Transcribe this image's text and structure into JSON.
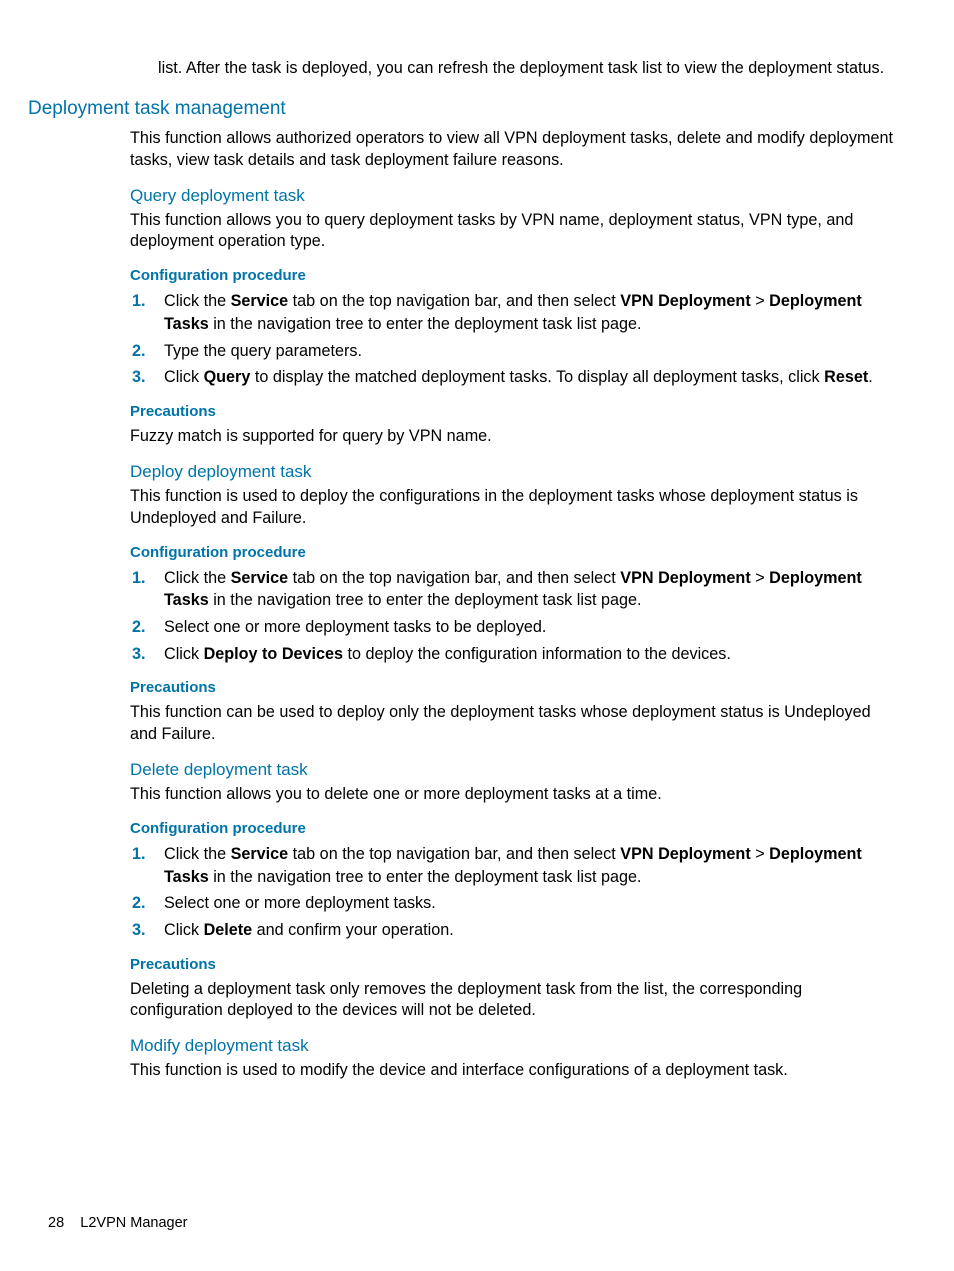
{
  "intro_continuation": "list. After the task is deployed, you can refresh the deployment task list to view the deployment status.",
  "h2_deploy_mgmt": "Deployment task management",
  "deploy_mgmt_desc": "This function allows authorized operators to view all VPN deployment tasks, delete and modify deployment tasks, view task details and task deployment failure reasons.",
  "h3_query": "Query deployment task",
  "query_desc": "This function allows you to query deployment tasks by VPN name, deployment status, VPN type, and deployment operation type.",
  "conf_proc_label": "Configuration procedure",
  "precautions_label": "Precautions",
  "steps_common_1_pre": "Click the ",
  "service_b": "Service",
  "steps_common_1_mid": " tab on the top navigation bar, and then select ",
  "vpn_dep_b": "VPN Deployment",
  "gt": " > ",
  "dep_tasks_b": "Deployment Tasks",
  "steps_common_1_post": " in the navigation tree to enter the deployment task list page.",
  "query_step2": "Type the query parameters.",
  "query_step3_pre": "Click ",
  "query_b": "Query",
  "query_step3_mid": " to display the matched deployment tasks. To display all deployment tasks, click ",
  "reset_b": "Reset",
  "period": ".",
  "query_prec": "Fuzzy match is supported for query by VPN name.",
  "h3_deploy": "Deploy deployment task",
  "deploy_desc": "This function is used to deploy the configurations in the deployment tasks whose deployment status is Undeployed and Failure.",
  "deploy_step2": "Select one or more deployment tasks to be deployed.",
  "deploy_step3_pre": "Click ",
  "deploy_devices_b": "Deploy to Devices",
  "deploy_step3_post": " to deploy the configuration information to the devices.",
  "deploy_prec": "This function can be used to deploy only the deployment tasks whose deployment status is Undeployed and Failure.",
  "h3_delete": "Delete deployment task",
  "delete_desc": "This function allows you to delete one or more deployment tasks at a time.",
  "delete_step2": "Select one or more deployment tasks.",
  "delete_step3_pre": "Click ",
  "delete_b": "Delete",
  "delete_step3_post": " and confirm your operation.",
  "delete_prec": "Deleting a deployment task only removes the deployment task from the list, the corresponding configuration deployed to the devices will not be deleted.",
  "h3_modify": "Modify deployment task",
  "modify_desc": "This function is used to modify the device and interface configurations of a deployment task.",
  "footer_page": "28",
  "footer_title": "L2VPN Manager"
}
